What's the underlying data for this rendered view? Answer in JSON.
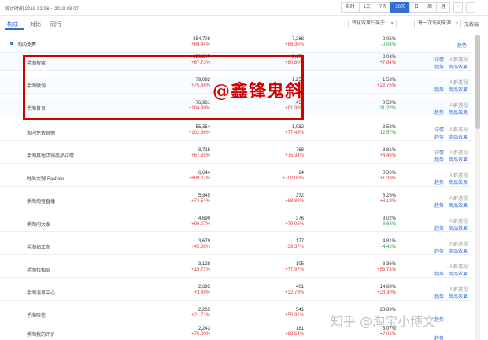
{
  "header": {
    "date_range": "统计时间 2019-02-06 ~ 2019-03-07",
    "ranges": [
      "实时",
      "1天",
      "7天",
      "30天",
      "日",
      "周",
      "月"
    ],
    "active_range": "30天",
    "prev": "‹",
    "next": "›"
  },
  "tabs": {
    "items": [
      "构成",
      "对比",
      "同行"
    ],
    "active": "构成"
  },
  "filters": {
    "select1": "转化效果归属于:",
    "select2": "每一次访问来源",
    "nodisplay": "无线端"
  },
  "rows": [
    {
      "name": "淘内免费",
      "v1": "354,708",
      "c1": "+86.44%",
      "v2": "7,268",
      "c2": "+86.36%",
      "v3": "2.05%",
      "c3": "-0.04%",
      "a1": "",
      "a2": "",
      "a3": "趋势",
      "a4": ""
    },
    {
      "name": "手淘搜索",
      "v1": "156,247",
      "c1": "+67.73%",
      "v2": "3,171",
      "c2": "+80.80%",
      "v3": "2.03%",
      "c3": "+7.84%",
      "a1": "详情",
      "a2": "人群透视",
      "a3": "趋势",
      "a4": "商品效果"
    },
    {
      "name": "手淘微淘",
      "v1": "79,092",
      "c1": "+75.66%",
      "v2": "1,253",
      "c2": "",
      "v3": "1.58%",
      "c3": "+22.75%",
      "a1": "",
      "a2": "人群透视",
      "a3": "趋势",
      "a4": "商品效果"
    },
    {
      "name": "手淘首页",
      "v1": "76,961",
      "c1": "+184.90%",
      "v2": "453",
      "c2": "+81.93%",
      "v3": "0.59%",
      "c3": "-31.22%",
      "a1": "",
      "a2": "人群透视",
      "a3": "趋势",
      "a4": "商品效果"
    },
    {
      "name": "淘内免费其他",
      "v1": "55,354",
      "c1": "+102.66%",
      "v2": "1,952",
      "c2": "+77.45%",
      "v3": "3.53%",
      "c3": "-12.57%",
      "a1": "详情",
      "a2": "人群透视",
      "a3": "趋势",
      "a4": "商品效果"
    },
    {
      "name": "手淘其他店铺商品详情",
      "v1": "8,715",
      "c1": "+67.85%",
      "v2": "768",
      "c2": "+75.34%",
      "v3": "8.81%",
      "c3": "+4.46%",
      "a1": "详情",
      "a2": "人群透视",
      "a3": "趋势",
      "a4": "商品效果"
    },
    {
      "name": "时尚大咖-Fashion",
      "v1": "6,644",
      "c1": "+689.07%",
      "v2": "24",
      "c2": "+700.00%",
      "v3": "0.36%",
      "c3": "+1.38%",
      "a1": "",
      "a2": "人群透视",
      "a3": "趋势",
      "a4": "商品效果"
    },
    {
      "name": "手淘淘宝直播",
      "v1": "5,945",
      "c1": "+74.54%",
      "v2": "372",
      "c2": "+88.83%",
      "v3": "6.26%",
      "c3": "+8.19%",
      "a1": "",
      "a2": "人群透视",
      "a3": "趋势",
      "a4": "商品效果"
    },
    {
      "name": "手淘问大家",
      "v1": "4,690",
      "c1": "+96.07%",
      "v2": "376",
      "c2": "+79.05%",
      "v3": "8.02%",
      "c3": "-8.68%",
      "a1": "",
      "a2": "人群透视",
      "a3": "趋势",
      "a4": "商品效果"
    },
    {
      "name": "手淘拍立淘",
      "v1": "3,679",
      "c1": "+45.88%",
      "v2": "177",
      "c2": "+39.37%",
      "v3": "4.81%",
      "c3": "-4.46%",
      "a1": "",
      "a2": "人群透视",
      "a3": "趋势",
      "a4": "商品效果"
    },
    {
      "name": "手淘找相似",
      "v1": "3,128",
      "c1": "+15.77%",
      "v2": "105",
      "c2": "+77.97%",
      "v3": "3.36%",
      "c3": "+53.73%",
      "a1": "",
      "a2": "人群透视",
      "a3": "趋势",
      "a4": "商品效果"
    },
    {
      "name": "手淘消息中心",
      "v1": "2,695",
      "c1": "+3.49%",
      "v2": "401",
      "c2": "+32.78%",
      "v3": "14.88%",
      "c3": "+28.30%",
      "a1": "",
      "a2": "人群透视",
      "a3": "趋势",
      "a4": "商品效果"
    },
    {
      "name": "手淘旺信",
      "v1": "2,265",
      "c1": "+21.71%",
      "v2": "541",
      "c2": "+55.91%",
      "v3": "23.89%",
      "c3": "",
      "a1": "",
      "a2": "",
      "a3": "趋势",
      "a4": ""
    },
    {
      "name": "手淘我的评价",
      "v1": "2,243",
      "c1": "+76.20%",
      "v2": "181",
      "c2": "+88.54%",
      "v3": "8.07%",
      "c3": "+7.01%",
      "a1": "",
      "a2": "",
      "a3": "趋势",
      "a4": ""
    }
  ],
  "overlay": {
    "text": "@鑫锋鬼斜"
  },
  "watermark": {
    "text": "知乎 @淘宝小博文"
  }
}
